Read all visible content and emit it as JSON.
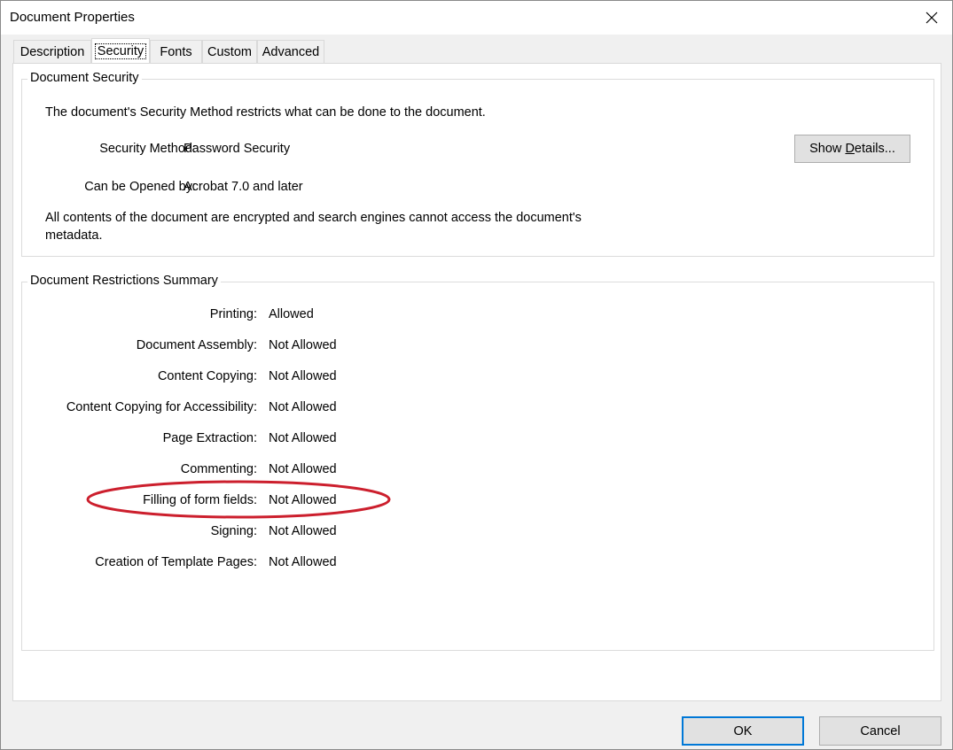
{
  "window": {
    "title": "Document Properties"
  },
  "tabs": [
    {
      "label": "Description",
      "active": false
    },
    {
      "label": "Security",
      "active": true
    },
    {
      "label": "Fonts",
      "active": false
    },
    {
      "label": "Custom",
      "active": false
    },
    {
      "label": "Advanced",
      "active": false
    }
  ],
  "security": {
    "group_title": "Document Security",
    "intro": "The document's Security Method restricts what can be done to the document.",
    "method_label": "Security Method:",
    "method_value": "Password Security",
    "opened_label": "Can be Opened by:",
    "opened_value": "Acrobat 7.0 and later",
    "note_line1": "All contents of the document are encrypted and search engines cannot access the document's",
    "note_line2": "metadata.",
    "show_details_prefix": "Show ",
    "show_details_mnemonic": "D",
    "show_details_suffix": "etails..."
  },
  "restrictions": {
    "group_title": "Document Restrictions Summary",
    "rows": [
      {
        "label": "Printing:",
        "value": "Allowed"
      },
      {
        "label": "Document Assembly:",
        "value": "Not Allowed"
      },
      {
        "label": "Content Copying:",
        "value": "Not Allowed"
      },
      {
        "label": "Content Copying for Accessibility:",
        "value": "Not Allowed"
      },
      {
        "label": "Page Extraction:",
        "value": "Not Allowed"
      },
      {
        "label": "Commenting:",
        "value": "Not Allowed"
      },
      {
        "label": "Filling of form fields:",
        "value": "Not Allowed"
      },
      {
        "label": "Signing:",
        "value": "Not Allowed"
      },
      {
        "label": "Creation of Template Pages:",
        "value": "Not Allowed"
      }
    ]
  },
  "footer": {
    "ok_label": "OK",
    "cancel_label": "Cancel"
  },
  "icons": {
    "close": "close-icon"
  },
  "colors": {
    "highlight": "#cc1f2d",
    "default_button_border": "#0078d7"
  }
}
